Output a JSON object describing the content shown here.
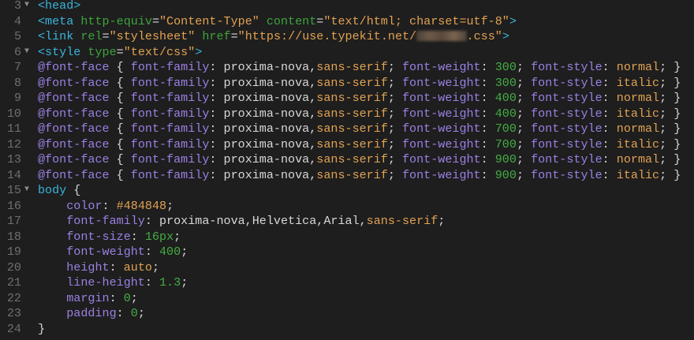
{
  "editor": {
    "colors": {
      "background": "#1e1e1e",
      "tag": "#39b3db",
      "attribute": "#3da43d",
      "string": "#e2a253",
      "property": "#9b80e3",
      "number": "#44ad44",
      "plain": "#d8d8d8",
      "line_number": "#6f6f6f"
    },
    "lines": [
      {
        "num": "3",
        "fold": true,
        "tokens": [
          [
            "tag",
            "<head>"
          ]
        ]
      },
      {
        "num": "4",
        "fold": false,
        "tokens": [
          [
            "tag",
            "<meta "
          ],
          [
            "attr",
            "http-equiv"
          ],
          [
            "punct",
            "="
          ],
          [
            "str",
            "\"Content-Type\""
          ],
          [
            "plain",
            " "
          ],
          [
            "attr",
            "content"
          ],
          [
            "punct",
            "="
          ],
          [
            "str",
            "\"text/html; charset=utf-8\""
          ],
          [
            "tag",
            ">"
          ]
        ]
      },
      {
        "num": "5",
        "fold": false,
        "tokens": [
          [
            "tag",
            "<link "
          ],
          [
            "attr",
            "rel"
          ],
          [
            "punct",
            "="
          ],
          [
            "str",
            "\"stylesheet\""
          ],
          [
            "plain",
            " "
          ],
          [
            "attr",
            "href"
          ],
          [
            "punct",
            "="
          ],
          [
            "str",
            "\"https://use.typekit.net/"
          ],
          [
            "blur",
            ""
          ],
          [
            "str",
            ".css\""
          ],
          [
            "tag",
            ">"
          ]
        ]
      },
      {
        "num": "6",
        "fold": true,
        "tokens": [
          [
            "tag",
            "<style "
          ],
          [
            "attr",
            "type"
          ],
          [
            "punct",
            "="
          ],
          [
            "str",
            "\"text/css\""
          ],
          [
            "tag",
            ">"
          ]
        ]
      },
      {
        "num": "7",
        "fold": false,
        "tokens": [
          [
            "prop",
            "@font-face"
          ],
          [
            "plain",
            " { "
          ],
          [
            "prop",
            "font-family"
          ],
          [
            "plain",
            ": proxima-nova,"
          ],
          [
            "str",
            "sans-serif"
          ],
          [
            "plain",
            "; "
          ],
          [
            "prop",
            "font-weight"
          ],
          [
            "plain",
            ": "
          ],
          [
            "num",
            "300"
          ],
          [
            "plain",
            "; "
          ],
          [
            "prop",
            "font-style"
          ],
          [
            "plain",
            ": "
          ],
          [
            "str",
            "normal"
          ],
          [
            "plain",
            "; }"
          ]
        ]
      },
      {
        "num": "8",
        "fold": false,
        "tokens": [
          [
            "prop",
            "@font-face"
          ],
          [
            "plain",
            " { "
          ],
          [
            "prop",
            "font-family"
          ],
          [
            "plain",
            ": proxima-nova,"
          ],
          [
            "str",
            "sans-serif"
          ],
          [
            "plain",
            "; "
          ],
          [
            "prop",
            "font-weight"
          ],
          [
            "plain",
            ": "
          ],
          [
            "num",
            "300"
          ],
          [
            "plain",
            "; "
          ],
          [
            "prop",
            "font-style"
          ],
          [
            "plain",
            ": "
          ],
          [
            "str",
            "italic"
          ],
          [
            "plain",
            "; }"
          ]
        ]
      },
      {
        "num": "9",
        "fold": false,
        "tokens": [
          [
            "prop",
            "@font-face"
          ],
          [
            "plain",
            " { "
          ],
          [
            "prop",
            "font-family"
          ],
          [
            "plain",
            ": proxima-nova,"
          ],
          [
            "str",
            "sans-serif"
          ],
          [
            "plain",
            "; "
          ],
          [
            "prop",
            "font-weight"
          ],
          [
            "plain",
            ": "
          ],
          [
            "num",
            "400"
          ],
          [
            "plain",
            "; "
          ],
          [
            "prop",
            "font-style"
          ],
          [
            "plain",
            ": "
          ],
          [
            "str",
            "normal"
          ],
          [
            "plain",
            "; }"
          ]
        ]
      },
      {
        "num": "10",
        "fold": false,
        "tokens": [
          [
            "prop",
            "@font-face"
          ],
          [
            "plain",
            " { "
          ],
          [
            "prop",
            "font-family"
          ],
          [
            "plain",
            ": proxima-nova,"
          ],
          [
            "str",
            "sans-serif"
          ],
          [
            "plain",
            "; "
          ],
          [
            "prop",
            "font-weight"
          ],
          [
            "plain",
            ": "
          ],
          [
            "num",
            "400"
          ],
          [
            "plain",
            "; "
          ],
          [
            "prop",
            "font-style"
          ],
          [
            "plain",
            ": "
          ],
          [
            "str",
            "italic"
          ],
          [
            "plain",
            "; }"
          ]
        ]
      },
      {
        "num": "11",
        "fold": false,
        "tokens": [
          [
            "prop",
            "@font-face"
          ],
          [
            "plain",
            " { "
          ],
          [
            "prop",
            "font-family"
          ],
          [
            "plain",
            ": proxima-nova,"
          ],
          [
            "str",
            "sans-serif"
          ],
          [
            "plain",
            "; "
          ],
          [
            "prop",
            "font-weight"
          ],
          [
            "plain",
            ": "
          ],
          [
            "num",
            "700"
          ],
          [
            "plain",
            "; "
          ],
          [
            "prop",
            "font-style"
          ],
          [
            "plain",
            ": "
          ],
          [
            "str",
            "normal"
          ],
          [
            "plain",
            "; }"
          ]
        ]
      },
      {
        "num": "12",
        "fold": false,
        "tokens": [
          [
            "prop",
            "@font-face"
          ],
          [
            "plain",
            " { "
          ],
          [
            "prop",
            "font-family"
          ],
          [
            "plain",
            ": proxima-nova,"
          ],
          [
            "str",
            "sans-serif"
          ],
          [
            "plain",
            "; "
          ],
          [
            "prop",
            "font-weight"
          ],
          [
            "plain",
            ": "
          ],
          [
            "num",
            "700"
          ],
          [
            "plain",
            "; "
          ],
          [
            "prop",
            "font-style"
          ],
          [
            "plain",
            ": "
          ],
          [
            "str",
            "italic"
          ],
          [
            "plain",
            "; }"
          ]
        ]
      },
      {
        "num": "13",
        "fold": false,
        "tokens": [
          [
            "prop",
            "@font-face"
          ],
          [
            "plain",
            " { "
          ],
          [
            "prop",
            "font-family"
          ],
          [
            "plain",
            ": proxima-nova,"
          ],
          [
            "str",
            "sans-serif"
          ],
          [
            "plain",
            "; "
          ],
          [
            "prop",
            "font-weight"
          ],
          [
            "plain",
            ": "
          ],
          [
            "num",
            "900"
          ],
          [
            "plain",
            "; "
          ],
          [
            "prop",
            "font-style"
          ],
          [
            "plain",
            ": "
          ],
          [
            "str",
            "normal"
          ],
          [
            "plain",
            "; }"
          ]
        ]
      },
      {
        "num": "14",
        "fold": false,
        "tokens": [
          [
            "prop",
            "@font-face"
          ],
          [
            "plain",
            " { "
          ],
          [
            "prop",
            "font-family"
          ],
          [
            "plain",
            ": proxima-nova,"
          ],
          [
            "str",
            "sans-serif"
          ],
          [
            "plain",
            "; "
          ],
          [
            "prop",
            "font-weight"
          ],
          [
            "plain",
            ": "
          ],
          [
            "num",
            "900"
          ],
          [
            "plain",
            "; "
          ],
          [
            "prop",
            "font-style"
          ],
          [
            "plain",
            ": "
          ],
          [
            "str",
            "italic"
          ],
          [
            "plain",
            "; }"
          ]
        ]
      },
      {
        "num": "15",
        "fold": true,
        "tokens": [
          [
            "tag",
            "body"
          ],
          [
            "plain",
            " {"
          ]
        ]
      },
      {
        "num": "16",
        "fold": false,
        "tokens": [
          [
            "plain",
            "    "
          ],
          [
            "prop",
            "color"
          ],
          [
            "plain",
            ": "
          ],
          [
            "str",
            "#484848"
          ],
          [
            "plain",
            ";"
          ]
        ]
      },
      {
        "num": "17",
        "fold": false,
        "tokens": [
          [
            "plain",
            "    "
          ],
          [
            "prop",
            "font-family"
          ],
          [
            "plain",
            ": proxima-nova,Helvetica,Arial,"
          ],
          [
            "str",
            "sans-serif"
          ],
          [
            "plain",
            ";"
          ]
        ]
      },
      {
        "num": "18",
        "fold": false,
        "tokens": [
          [
            "plain",
            "    "
          ],
          [
            "prop",
            "font-size"
          ],
          [
            "plain",
            ": "
          ],
          [
            "num",
            "16px"
          ],
          [
            "plain",
            ";"
          ]
        ]
      },
      {
        "num": "19",
        "fold": false,
        "tokens": [
          [
            "plain",
            "    "
          ],
          [
            "prop",
            "font-weight"
          ],
          [
            "plain",
            ": "
          ],
          [
            "num",
            "400"
          ],
          [
            "plain",
            ";"
          ]
        ]
      },
      {
        "num": "20",
        "fold": false,
        "tokens": [
          [
            "plain",
            "    "
          ],
          [
            "prop",
            "height"
          ],
          [
            "plain",
            ": "
          ],
          [
            "str",
            "auto"
          ],
          [
            "plain",
            ";"
          ]
        ]
      },
      {
        "num": "21",
        "fold": false,
        "tokens": [
          [
            "plain",
            "    "
          ],
          [
            "prop",
            "line-height"
          ],
          [
            "plain",
            ": "
          ],
          [
            "num",
            "1.3"
          ],
          [
            "plain",
            ";"
          ]
        ]
      },
      {
        "num": "22",
        "fold": false,
        "tokens": [
          [
            "plain",
            "    "
          ],
          [
            "prop",
            "margin"
          ],
          [
            "plain",
            ": "
          ],
          [
            "num",
            "0"
          ],
          [
            "plain",
            ";"
          ]
        ]
      },
      {
        "num": "23",
        "fold": false,
        "tokens": [
          [
            "plain",
            "    "
          ],
          [
            "prop",
            "padding"
          ],
          [
            "plain",
            ": "
          ],
          [
            "num",
            "0"
          ],
          [
            "plain",
            ";"
          ]
        ]
      },
      {
        "num": "24",
        "fold": false,
        "tokens": [
          [
            "plain",
            "}"
          ]
        ]
      }
    ],
    "fold_glyph": "▼"
  }
}
